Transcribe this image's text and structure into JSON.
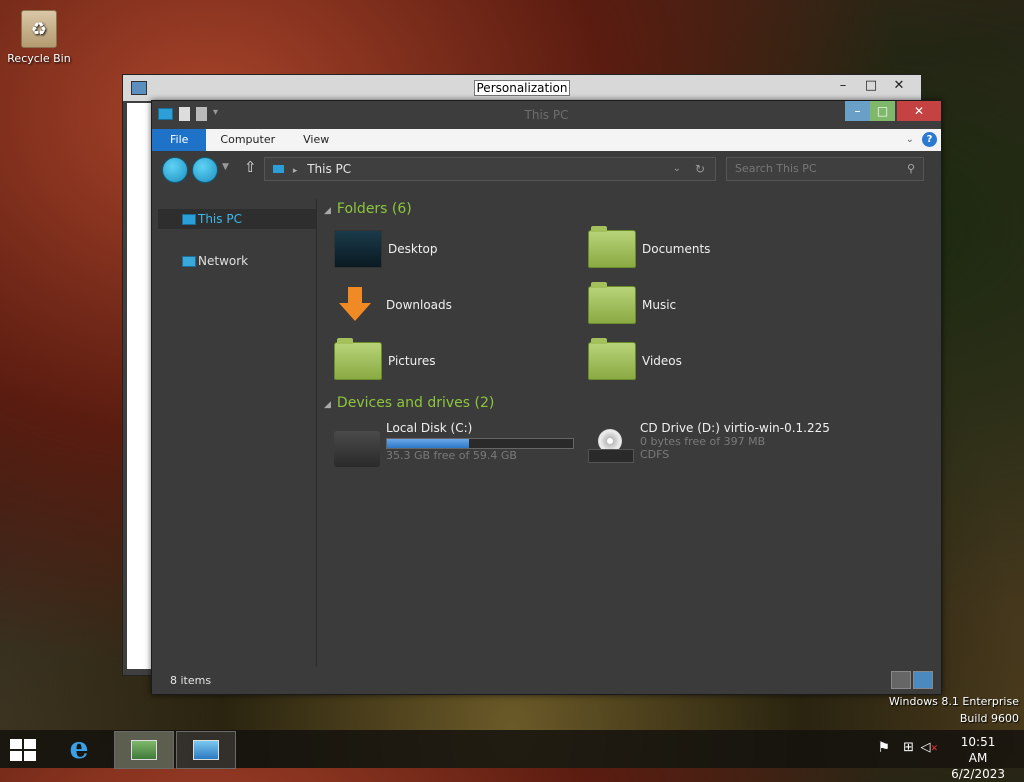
{
  "desktop": {
    "recycle_bin_label": "Recycle Bin"
  },
  "back_window": {
    "title": "Personalization"
  },
  "window": {
    "title": "This PC",
    "ribbon_tabs": [
      "File",
      "Computer",
      "View"
    ],
    "help_label": "?",
    "address": "This PC",
    "search_placeholder": "Search This PC",
    "nav": [
      {
        "label": "This PC",
        "selected": true
      },
      {
        "label": "Network",
        "selected": false
      }
    ],
    "folders_header": "Folders (6)",
    "folders": [
      {
        "name": "Desktop"
      },
      {
        "name": "Documents"
      },
      {
        "name": "Downloads"
      },
      {
        "name": "Music"
      },
      {
        "name": "Pictures"
      },
      {
        "name": "Videos"
      }
    ],
    "devices_header": "Devices and drives (2)",
    "drives": [
      {
        "name": "Local Disk (C:)",
        "detail": "35.3 GB free of 59.4 GB",
        "used_fraction": 0.44
      },
      {
        "name": "CD Drive (D:) virtio-win-0.1.225",
        "detail": "0 bytes free of 397 MB",
        "fs": "CDFS"
      }
    ],
    "status_count": "8 items"
  },
  "watermark": {
    "line1": "Windows 8.1 Enterprise",
    "line2": "Build 9600"
  },
  "taskbar": {
    "time": "10:51 AM",
    "date": "6/2/2023"
  },
  "colors": {
    "accent": "#1e73c8",
    "group_header": "#8cc63e",
    "selection": "#3fb8e8"
  }
}
